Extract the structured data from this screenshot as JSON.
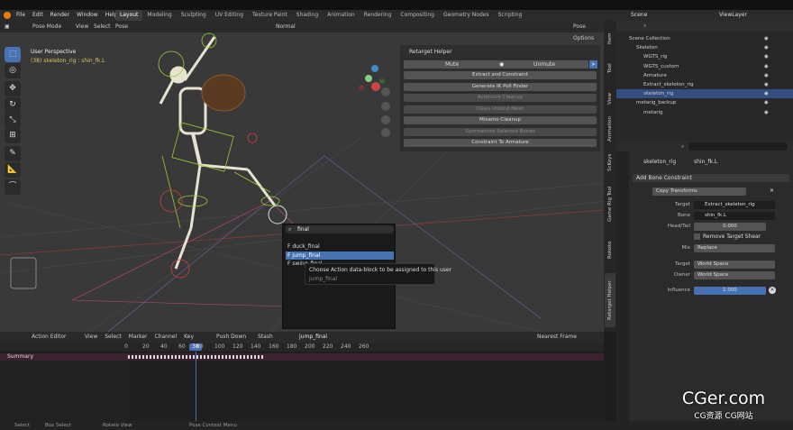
{
  "topmenu": [
    "File",
    "Edit",
    "Render",
    "Window",
    "Help"
  ],
  "workspaces": [
    "Layout",
    "Modeling",
    "Sculpting",
    "UV Editing",
    "Texture Paint",
    "Shading",
    "Animation",
    "Rendering",
    "Compositing",
    "Geometry Nodes",
    "Scripting"
  ],
  "scene_name": "Scene",
  "viewlayer_name": "ViewLayer",
  "viewport": {
    "mode": "Pose Mode",
    "menus": [
      "View",
      "Select",
      "Pose"
    ],
    "orientation": "Normal",
    "pose_options": "Pose Options",
    "view_name": "User Perspective",
    "object_info": "(38) skeleton_rig : shin_fk.L"
  },
  "retarget": {
    "title": "Retarget Helper",
    "mute": "Mute",
    "unmute": "Unmute",
    "buttons": [
      {
        "label": "Extract and Constraint",
        "disabled": false
      },
      {
        "label": "Generate IK Poll Finder",
        "disabled": false
      },
      {
        "label": "Actorcom Cleanup",
        "disabled": true
      },
      {
        "label": "Clean Unbind Mesh",
        "disabled": true
      },
      {
        "label": "Mixamo Cleanup",
        "disabled": false
      },
      {
        "label": "Symmetrize Selected Bones",
        "disabled": true
      },
      {
        "label": "Constraint To Armature",
        "disabled": false
      }
    ]
  },
  "vtabs": [
    "Item",
    "Tool",
    "View",
    "Animation",
    "ScKeys",
    "Game Rig Tool",
    "Rokoko",
    "Retarget Helper"
  ],
  "outliner": {
    "rows": [
      {
        "indent": 0,
        "label": "Scene Collection",
        "sel": false
      },
      {
        "indent": 1,
        "label": "Skeleton",
        "sel": false
      },
      {
        "indent": 2,
        "label": "WGTS_rig",
        "sel": false
      },
      {
        "indent": 2,
        "label": "WGTS_custom",
        "sel": false
      },
      {
        "indent": 2,
        "label": "Armature",
        "sel": false
      },
      {
        "indent": 2,
        "label": "Extract_skeleton_rig",
        "sel": false
      },
      {
        "indent": 2,
        "label": "skeleton_rig",
        "sel": true
      },
      {
        "indent": 1,
        "label": "metarig_backup",
        "sel": false
      },
      {
        "indent": 2,
        "label": "metarig",
        "sel": false
      }
    ]
  },
  "props": {
    "breadcrumb_obj": "skeleton_rig",
    "breadcrumb_bone": "shin_fk.L",
    "add_constraint": "Add Bone Constraint",
    "constraint_name": "Copy Transforms",
    "target_label": "Target",
    "target_value": "Extract_skeleton_rig",
    "bone_label": "Bone",
    "bone_value": "shin_fk.L",
    "headtail_label": "Head/Tail",
    "headtail_value": "0.000",
    "remove_shear": "Remove Target Shear",
    "mix_label": "Mix",
    "mix_value": "Replace",
    "target_space_label": "Target",
    "target_space_value": "World Space",
    "owner_label": "Owner",
    "owner_value": "World Space",
    "influence_label": "Influence",
    "influence_value": "1.000"
  },
  "popup": {
    "search": "final",
    "items": [
      {
        "label": "F duck_final",
        "sel": false
      },
      {
        "label": "F jump_final",
        "sel": true
      },
      {
        "label": "F swing_final",
        "sel": false
      }
    ]
  },
  "tooltip": {
    "text": "Choose Action data-block to be assigned to this user",
    "sub": "jump_final"
  },
  "timeline": {
    "editor": "Action Editor",
    "menus": [
      "View",
      "Select",
      "Marker",
      "Channel",
      "Key"
    ],
    "push_down": "Push Down",
    "stash": "Stash",
    "action_name": "jump_final",
    "snapping": "Nearest Frame",
    "current_frame": "38",
    "frames": [
      "0",
      "20",
      "40",
      "60",
      "80",
      "100",
      "120",
      "140",
      "160",
      "180",
      "200",
      "220",
      "240",
      "260"
    ],
    "summary": "Summary"
  },
  "status": {
    "select": "Select",
    "box": "Box Select",
    "rotate": "Rotate View",
    "context": "Pose Context Menu"
  },
  "watermark": {
    "title": "CGer.com",
    "sub": "CG资源  CG网站"
  },
  "colors": {
    "accent": "#4772b3",
    "selected_row": "#334d80",
    "bone_green": "#9acd32",
    "ik_red": "#d04040"
  }
}
